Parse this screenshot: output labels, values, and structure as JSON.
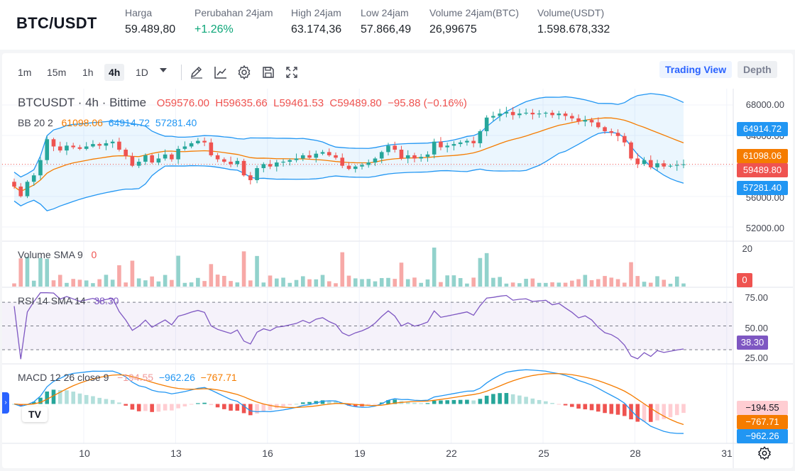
{
  "ticker": {
    "pair": "BTC/USDT",
    "stats": [
      {
        "label": "Harga",
        "value": "59.489,80",
        "color": "#1e2329"
      },
      {
        "label": "Perubahan 24jam",
        "value": "+1.26%",
        "color": "#0ca678"
      },
      {
        "label": "High 24jam",
        "value": "63.174,36",
        "color": "#1e2329"
      },
      {
        "label": "Low 24jam",
        "value": "57.866,49",
        "color": "#1e2329"
      },
      {
        "label": "Volume 24jam(BTC)",
        "value": "26,99675",
        "color": "#1e2329"
      },
      {
        "label": "Volume(USDT)",
        "value": "1.598.678,332",
        "color": "#1e2329"
      }
    ]
  },
  "toolbar": {
    "timeframes": [
      "1m",
      "15m",
      "1h",
      "4h",
      "1D"
    ],
    "active_timeframe": "4h",
    "tools": [
      "pencil-icon",
      "line-chart-icon",
      "gear-icon",
      "save-icon",
      "fullscreen-icon"
    ],
    "views": [
      "Trading View",
      "Depth"
    ],
    "active_view": "Trading View"
  },
  "legend": {
    "symbol": "BTCUSDT · 4h · Bittime",
    "open": "O59576.00",
    "high": "H59635.66",
    "low": "L59461.53",
    "close": "C59489.80",
    "change": "−95.88 (−0.16%)",
    "bb_name": "BB 20 2",
    "bb_basis": "61098.06",
    "bb_upper": "64914.72",
    "bb_lower": "57281.40",
    "vol_name": "Volume SMA 9",
    "vol_value": "0",
    "rsi_name": "RSI 14 SMA 14",
    "rsi_value": "38.30",
    "macd_name": "MACD 12 26 close 9",
    "macd_hist": "−194.55",
    "macd_line": "−962.26",
    "macd_signal": "−767.71"
  },
  "price_axis": {
    "ticks": [
      "68000.00",
      "64000.00",
      "60000.00",
      "56000.00",
      "52000.00"
    ],
    "tags": {
      "upper": "64914.72",
      "basis": "61098.06",
      "last": "59489.80",
      "lower": "57281.40"
    }
  },
  "volume_axis": {
    "ticks": [
      "20"
    ],
    "tag": "0"
  },
  "rsi_axis": {
    "ticks": [
      "75.00",
      "50.00",
      "25.00"
    ],
    "tag": "38.30"
  },
  "macd_axis": {
    "tags": {
      "hist": "−194.55",
      "signal": "−767.71",
      "macd": "−962.26"
    }
  },
  "time_axis": {
    "labels": [
      "10",
      "13",
      "16",
      "19",
      "22",
      "25",
      "28",
      "31"
    ]
  },
  "colors": {
    "up": "#26a69a",
    "down": "#ef5350",
    "bb_band": "#2196f3",
    "bb_basis": "#f57c00",
    "rsi": "#7e57c2",
    "macd": "#2196f3",
    "signal": "#f57c00"
  },
  "chart_data": {
    "type": "candlestick",
    "symbol": "BTCUSDT",
    "interval": "4h",
    "price_range": [
      50000,
      69000
    ],
    "x_ticks": [
      "10",
      "13",
      "16",
      "19",
      "22",
      "25",
      "28",
      "31"
    ],
    "closes": [
      56800,
      55600,
      57400,
      58200,
      60100,
      62700,
      61800,
      61300,
      61900,
      61700,
      61500,
      61800,
      62100,
      61900,
      62200,
      62400,
      61400,
      60600,
      59400,
      59900,
      60700,
      59800,
      60300,
      60800,
      60200,
      61500,
      61800,
      62200,
      62500,
      62300,
      60700,
      60200,
      59900,
      59600,
      60000,
      58200,
      57600,
      59100,
      59600,
      59300,
      59800,
      59900,
      60100,
      60300,
      60700,
      60400,
      60900,
      61100,
      60700,
      60400,
      59400,
      59000,
      59300,
      59500,
      59800,
      60300,
      61100,
      61900,
      61400,
      60300,
      60700,
      60300,
      60500,
      60800,
      62400,
      61700,
      61900,
      62100,
      62300,
      62500,
      62200,
      63700,
      65400,
      65600,
      65900,
      66100,
      65700,
      65900,
      66000,
      65800,
      65900,
      66000,
      65700,
      65900,
      65600,
      65300,
      64900,
      65100,
      64800,
      64200,
      63700,
      63500,
      63100,
      62300,
      60300,
      59600,
      60100,
      59200,
      59700,
      59300,
      59400,
      59500,
      59576
    ]
  }
}
